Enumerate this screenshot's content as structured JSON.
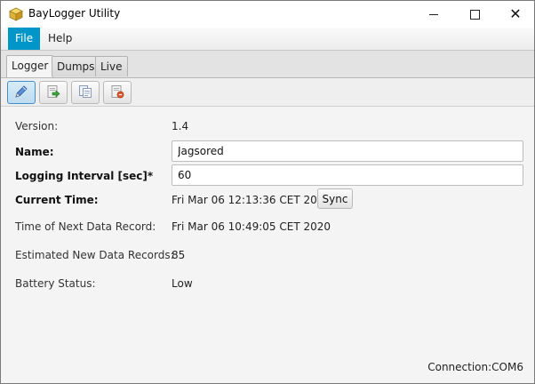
{
  "window": {
    "title": "BayLogger Utility",
    "minimize": "–",
    "maximize": "□",
    "close": "✕"
  },
  "menu": {
    "file": "File",
    "help": "Help"
  },
  "tabs": [
    {
      "label": "Logger",
      "active": true
    },
    {
      "label": "Dumps",
      "active": false
    },
    {
      "label": "Live",
      "active": false
    }
  ],
  "toolbar": {
    "buttons": [
      {
        "icon": "pencil-icon",
        "pressed": true
      },
      {
        "icon": "export-icon",
        "pressed": false
      },
      {
        "icon": "copy-icon",
        "pressed": false
      },
      {
        "icon": "erase-icon",
        "pressed": false
      }
    ]
  },
  "form": {
    "version": {
      "label": "Version:",
      "value": "1.4"
    },
    "name": {
      "label": "Name:",
      "value": "Jagsored"
    },
    "interval": {
      "label": "Logging Interval [sec]*",
      "value": "60"
    },
    "current_time": {
      "label": "Current Time:",
      "value": "Fri Mar 06 12:13:36 CET 2020",
      "sync_label": "Sync"
    },
    "next_record": {
      "label": "Time of Next Data Record:",
      "value": "Fri Mar 06 10:49:05 CET 2020"
    },
    "estimated": {
      "label": "Estimated New Data Records:",
      "value": "85"
    },
    "battery": {
      "label": "Battery Status:",
      "value": "Low"
    }
  },
  "status": {
    "connection": "Connection:COM6"
  },
  "colors": {
    "accent": "#0096c9",
    "window_bg": "#f4f4f4"
  }
}
